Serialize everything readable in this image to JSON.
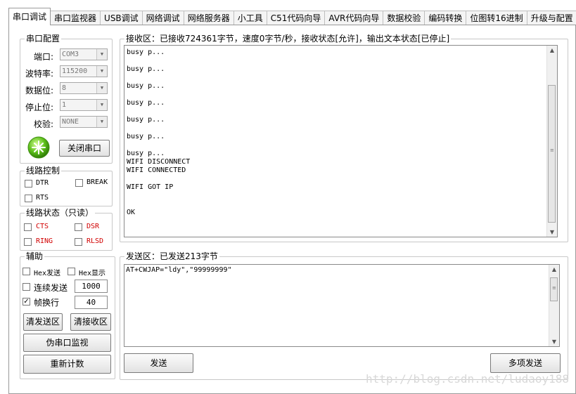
{
  "tabs": [
    {
      "label": "串口调试",
      "active": true
    },
    {
      "label": "串口监视器"
    },
    {
      "label": "USB调试"
    },
    {
      "label": "网络调试"
    },
    {
      "label": "网络服务器"
    },
    {
      "label": "小工具"
    },
    {
      "label": "C51代码向导"
    },
    {
      "label": "AVR代码向导"
    },
    {
      "label": "数据校验"
    },
    {
      "label": "编码转换"
    },
    {
      "label": "位图转16进制"
    },
    {
      "label": "升级与配置"
    }
  ],
  "serial_config": {
    "title": "串口配置",
    "port_label": "端口:",
    "port_value": "COM3",
    "baud_label": "波特率:",
    "baud_value": "115200",
    "databits_label": "数据位:",
    "databits_value": "8",
    "stopbits_label": "停止位:",
    "stopbits_value": "1",
    "parity_label": "校验:",
    "parity_value": "NONE",
    "close_button": "关闭串口"
  },
  "line_control": {
    "title": "线路控制",
    "dtr": "DTR",
    "break": "BREAK",
    "rts": "RTS"
  },
  "line_status": {
    "title": "线路状态（只读）",
    "cts": "CTS",
    "dsr": "DSR",
    "ring": "RING",
    "rlsd": "RLSD",
    "color": "#d10000"
  },
  "aux": {
    "title": "辅助",
    "hex_send": "Hex发送",
    "hex_display": "Hex显示",
    "continuous_send": "连续发送",
    "continuous_interval": "1000",
    "frame_newline": "帧换行",
    "frame_newline_checked": true,
    "frame_value": "40",
    "clear_send_button": "清发送区",
    "clear_recv_button": "清接收区",
    "pseudo_monitor_button": "伪串口监视",
    "reset_count_button": "重新计数"
  },
  "receive": {
    "title": "接收区：已接收724361字节，速度0字节/秒，接收状态[允许]，输出文本状态[已停止]",
    "lines": [
      "busy p...",
      "",
      "busy p...",
      "",
      "busy p...",
      "",
      "busy p...",
      "",
      "busy p...",
      "",
      "busy p...",
      "",
      "busy p...",
      "WIFI DISCONNECT",
      "WIFI CONNECTED",
      "",
      "WIFI GOT IP",
      "",
      "",
      "OK"
    ]
  },
  "send": {
    "title": "发送区：已发送213字节",
    "content": "AT+CWJAP=\"ldy\",\"99999999\"",
    "send_button": "发送",
    "multi_send_button": "多项发送"
  },
  "watermark": "http://blog.csdn.net/ludaoy188"
}
